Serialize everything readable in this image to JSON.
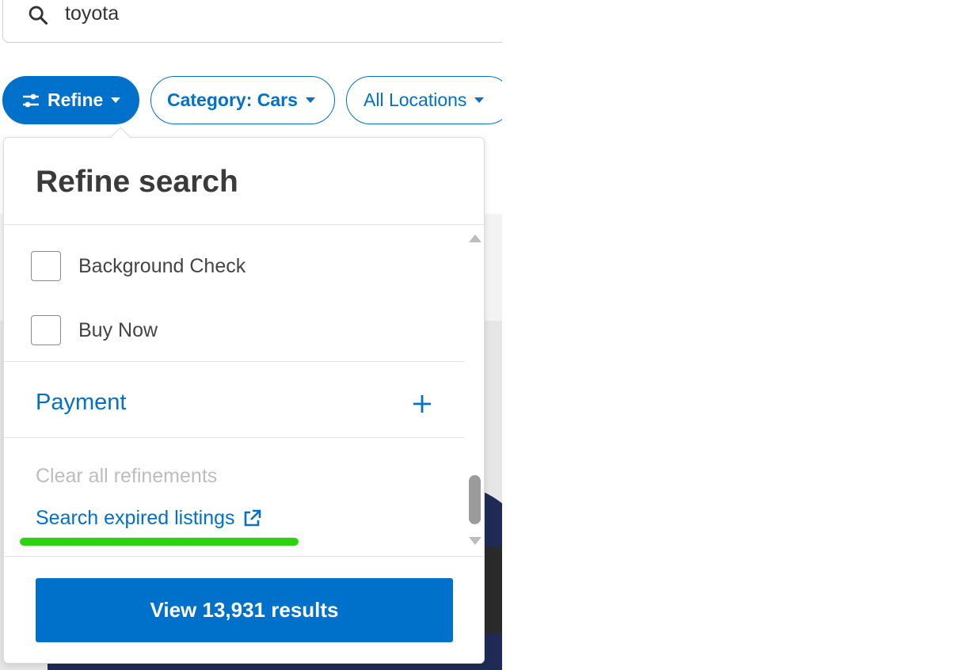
{
  "search": {
    "value": "toyota",
    "icon": "search-icon"
  },
  "filters": {
    "refine_label": "Refine",
    "category_label": "Category: Cars",
    "location_label": "All Locations"
  },
  "panel": {
    "title": "Refine search",
    "options": [
      {
        "label": "Background Check",
        "checked": false
      },
      {
        "label": "Buy Now",
        "checked": false
      }
    ],
    "payment_label": "Payment",
    "clear_label": "Clear all refinements",
    "expired_label": "Search expired listings",
    "view_results_label": "View 13,931 results"
  },
  "colors": {
    "accent": "#0071cb",
    "disabled_text": "#bdbdbd",
    "highlight_mark": "#2bd40f"
  }
}
